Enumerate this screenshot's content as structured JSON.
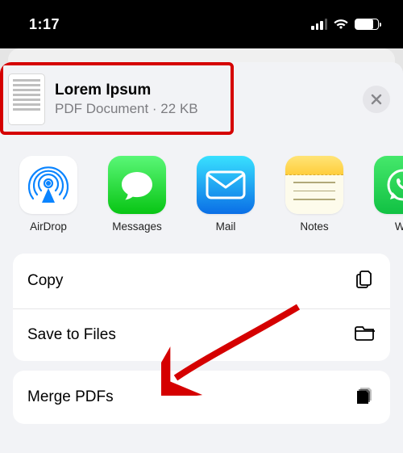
{
  "status": {
    "time": "1:17"
  },
  "header": {
    "title": "Lorem Ipsum",
    "subtitle": "PDF Document · 22 KB"
  },
  "apps": {
    "airdrop": "AirDrop",
    "messages": "Messages",
    "mail": "Mail",
    "notes": "Notes",
    "whatsapp": "Wh"
  },
  "actions": {
    "copy": "Copy",
    "save_to_files": "Save to Files",
    "merge_pdfs": "Merge PDFs"
  }
}
